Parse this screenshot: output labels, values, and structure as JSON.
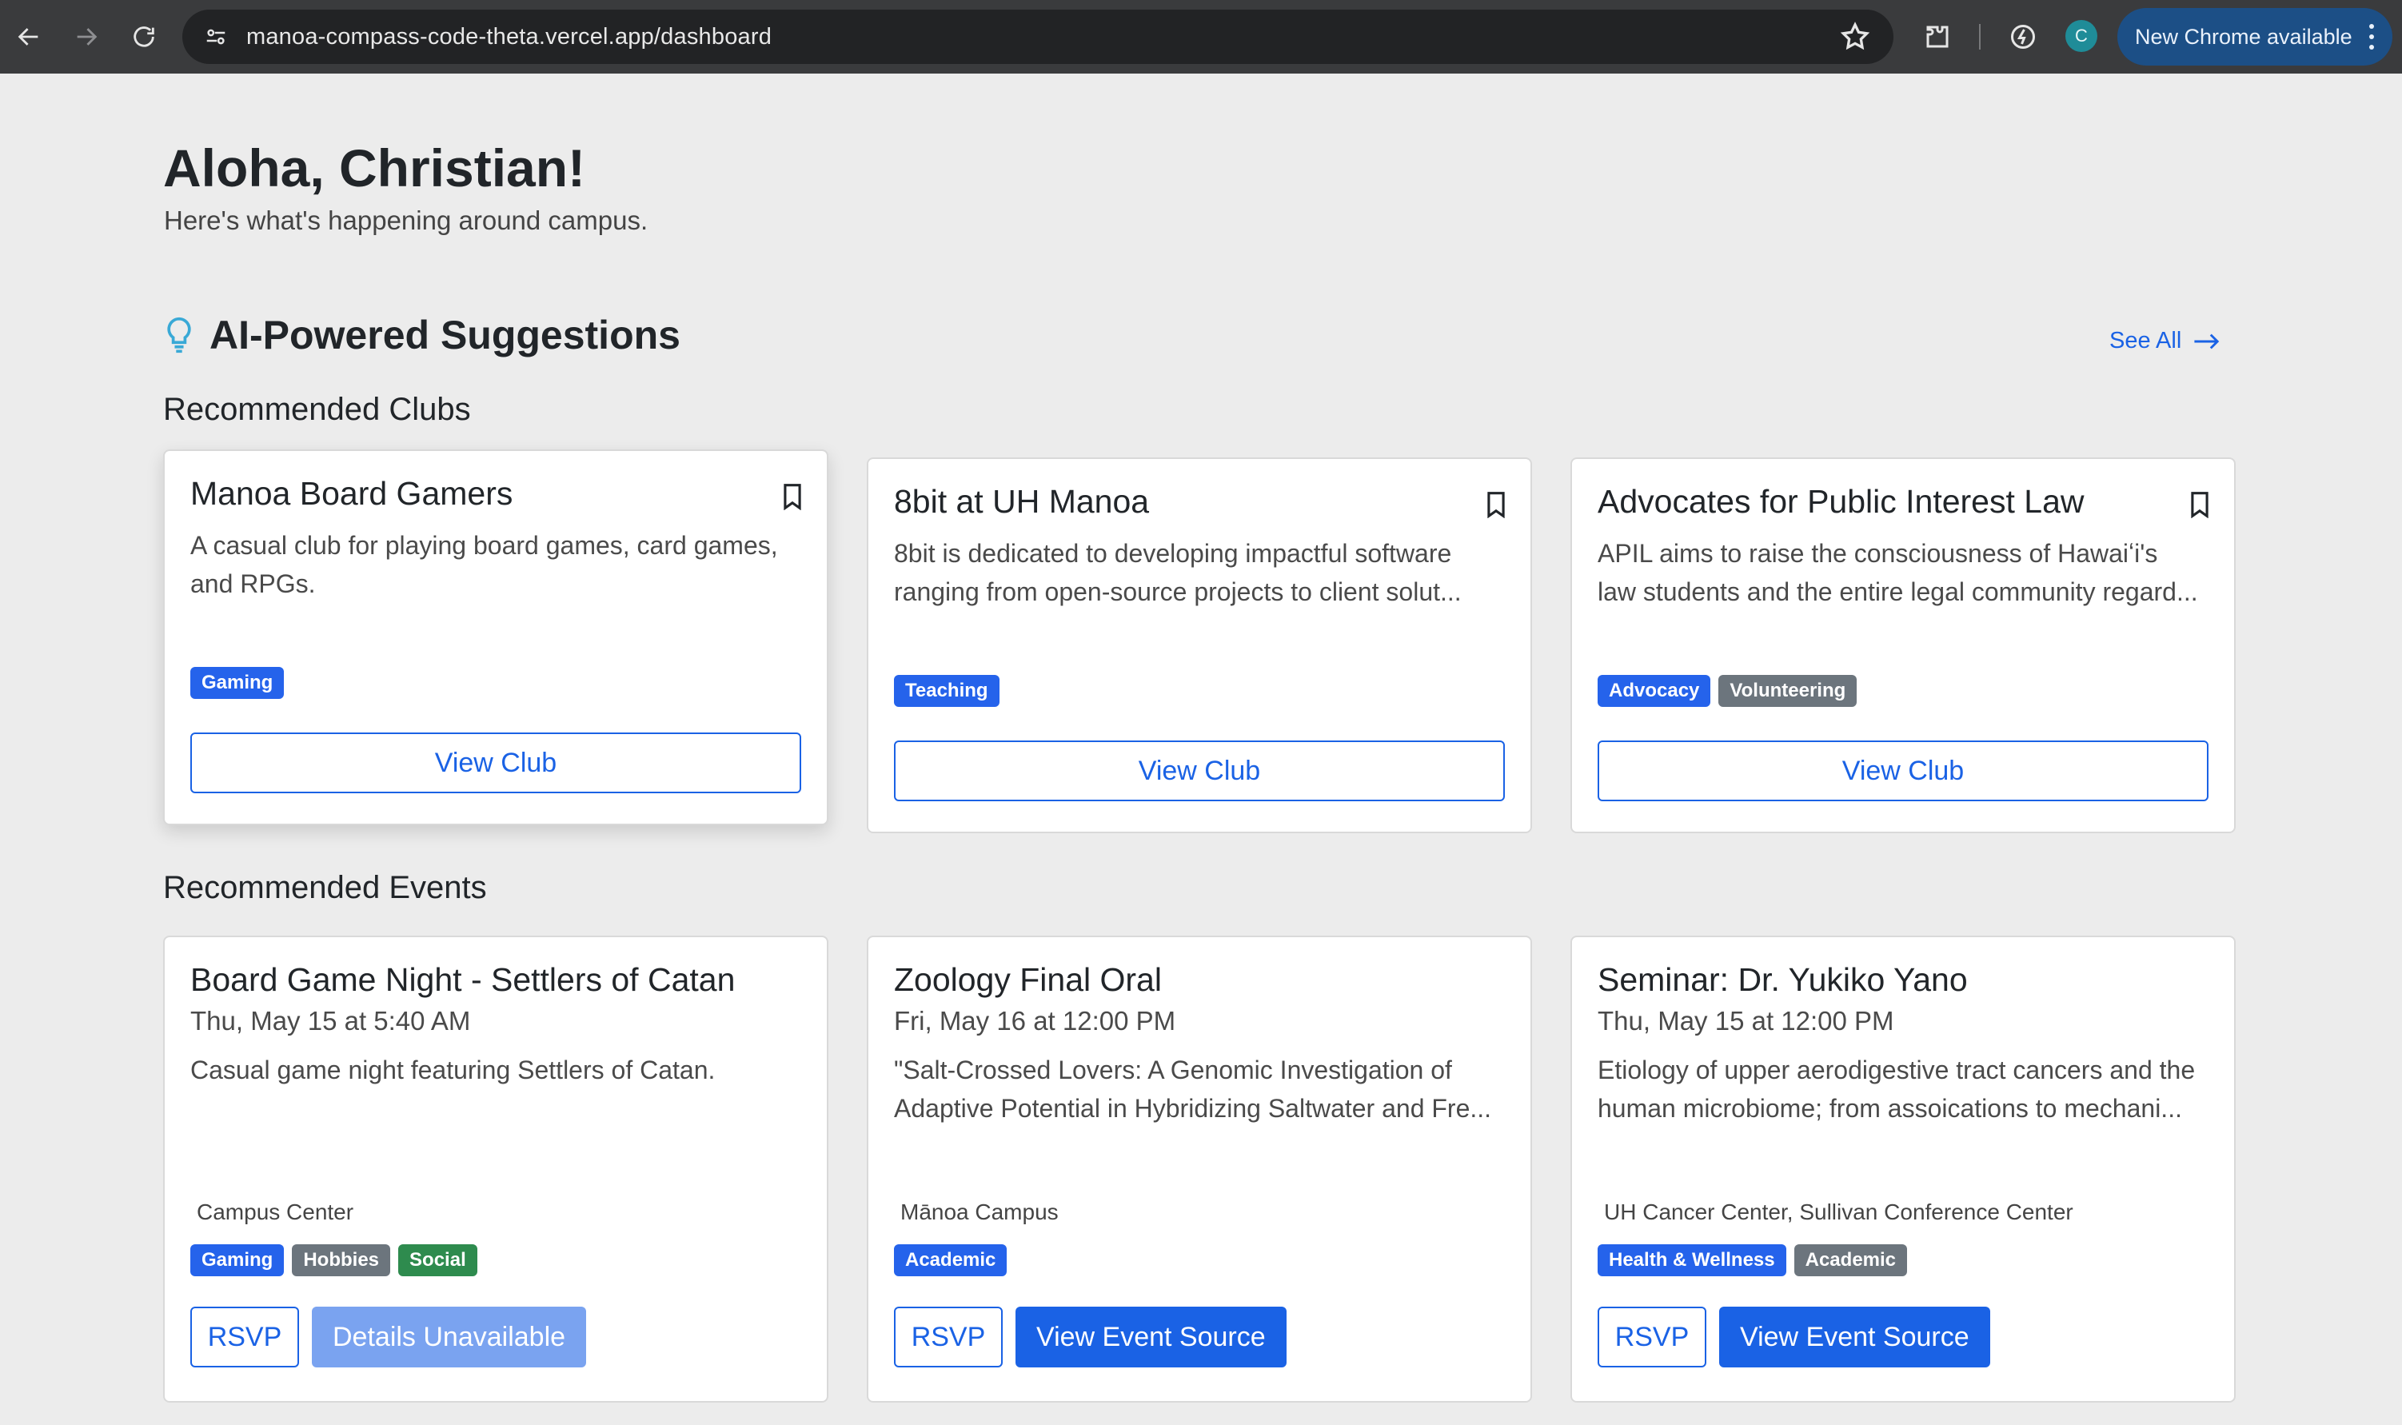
{
  "browser": {
    "url": "manoa-compass-code-theta.vercel.app/dashboard",
    "profile_initial": "C",
    "update_label": "New Chrome available"
  },
  "header": {
    "greeting": "Aloha, Christian!",
    "subtitle": "Here's what's happening around campus."
  },
  "suggestions": {
    "title": "AI-Powered Suggestions",
    "see_all": "See All"
  },
  "clubs": {
    "heading": "Recommended Clubs",
    "button_label": "View Club",
    "items": [
      {
        "name": "Manoa Board Gamers",
        "description": "A casual club for playing board games, card games, and RPGs.",
        "tags": [
          {
            "label": "Gaming"
          }
        ]
      },
      {
        "name": "8bit at UH Manoa",
        "description": "8bit is dedicated to developing impactful software ranging from open-source projects to client solut...",
        "tags": [
          {
            "label": "Teaching"
          }
        ]
      },
      {
        "name": "Advocates for Public Interest Law",
        "description": "APIL aims to raise the consciousness of Hawaiʻi's law students and the entire legal community regard...",
        "tags": [
          {
            "label": "Advocacy"
          },
          {
            "label": "Volunteering"
          }
        ]
      }
    ]
  },
  "events": {
    "heading": "Recommended Events",
    "rsvp_label": "RSVP",
    "items": [
      {
        "title": "Board Game Night - Settlers of Catan",
        "date": "Thu, May 15 at 5:40 AM",
        "description": "Casual game night featuring Settlers of Catan.",
        "location": "Campus Center",
        "tags": [
          {
            "label": "Gaming"
          },
          {
            "label": "Hobbies"
          },
          {
            "label": "Social"
          }
        ],
        "secondary_label": "Details Unavailable"
      },
      {
        "title": "Zoology Final Oral",
        "date": "Fri, May 16 at 12:00 PM",
        "description": "\"Salt-Crossed Lovers: A Genomic Investigation of Adaptive Potential in Hybridizing Saltwater and Fre...",
        "location": "Mānoa Campus",
        "tags": [
          {
            "label": "Academic"
          }
        ],
        "secondary_label": "View Event Source"
      },
      {
        "title": "Seminar: Dr. Yukiko Yano",
        "date": "Thu, May 15 at 12:00 PM",
        "description": "Etiology of upper aerodigestive tract cancers and the human microbiome; from assoications to mechani...",
        "location": "UH Cancer Center, Sullivan Conference Center",
        "tags": [
          {
            "label": "Health & Wellness"
          },
          {
            "label": "Academic"
          }
        ],
        "secondary_label": "View Event Source"
      }
    ]
  }
}
